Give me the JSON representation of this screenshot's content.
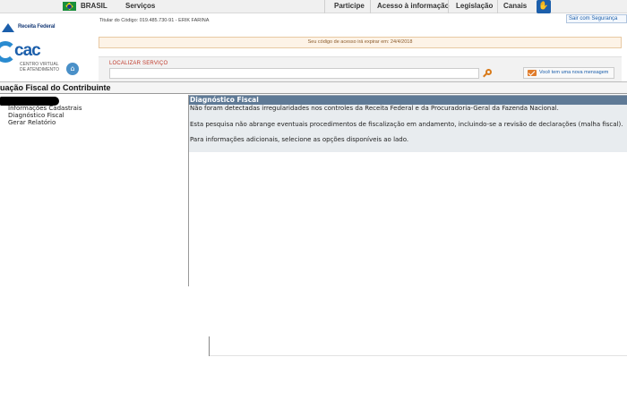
{
  "govbar": {
    "country": "BRASIL",
    "services": "Serviços",
    "links": [
      "Participe",
      "Acesso à informação",
      "Legislação",
      "Canais"
    ]
  },
  "header": {
    "brand": "Receita Federal",
    "ecac": "cac",
    "ecac_sub_1": "CENTRO VIRTUAL",
    "ecac_sub_2": "DE ATENDIMENTO",
    "titular": "Titular do Código: 019.485.730-91 - ERIK FARINA",
    "logout": "Sair com Segurança",
    "expire_notice": "Seu código de acesso irá expirar em: 24/4/2018"
  },
  "search": {
    "label": "LOCALIZAR SERVIÇO",
    "value": "",
    "message_button": "Você tem uma nova mensagem"
  },
  "page": {
    "title": "uação Fiscal do Contribuinte"
  },
  "menu": {
    "items": [
      "Informações Cadastrais",
      "Diagnóstico Fiscal",
      "Gerar Relatório"
    ]
  },
  "content": {
    "heading": "Diagnóstico Fiscal",
    "line1": "Não foram detectadas irregularidades nos controles da Receita Federal e da Procuradoria-Geral da Fazenda Nacional.",
    "line2": "Esta pesquisa não abrange eventuais procedimentos de fiscalização em andamento, incluindo-se a revisão de declarações (malha fiscal).",
    "line3": "Para informações adicionais, selecione as opções disponíveis ao lado."
  },
  "colors": {
    "content_head_bg": "#5f7a96",
    "content_bg": "#e8ecef",
    "brand_blue": "#1c5fab",
    "search_label": "#c0392b"
  },
  "icons": [
    "brazil-flag-icon",
    "accessibility-icon",
    "receita-federal-logo",
    "home-icon",
    "search-icon",
    "mail-icon"
  ]
}
